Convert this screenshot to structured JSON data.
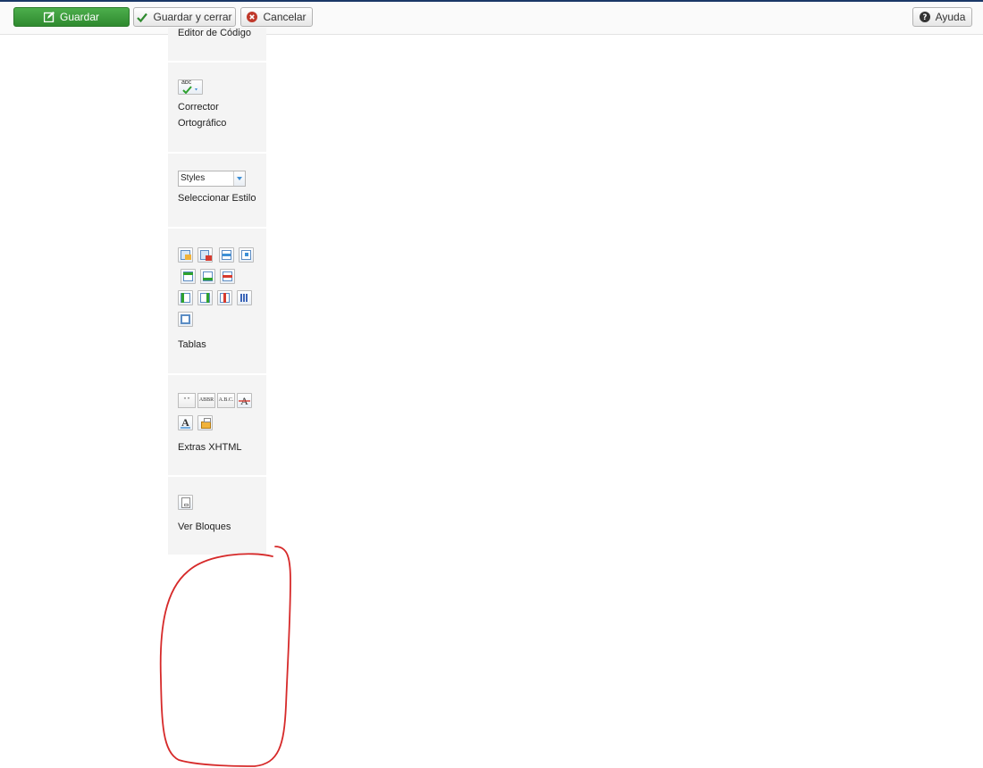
{
  "toolbar": {
    "save_label": "Guardar",
    "save_close_label": "Guardar y cerrar",
    "cancel_label": "Cancelar",
    "help_label": "Ayuda"
  },
  "editor_plugins": {
    "code_editor": {
      "label": "Editor de Código"
    },
    "spell_checker": {
      "label_line1": "Corrector",
      "label_line2": "Ortográfico",
      "icon_text": "abc"
    },
    "style_select": {
      "select_value": "Styles",
      "label": "Seleccionar Estilo"
    },
    "tables": {
      "label": "Tablas"
    },
    "xhtml_extras": {
      "label": "Extras XHTML",
      "icon_cite": "“ ”",
      "icon_abbr": "ABBR",
      "icon_acronym": "A.B.C."
    },
    "show_blocks": {
      "label": "Ver Bloques"
    }
  },
  "colors": {
    "save_button": "#3c9a3c",
    "annotation_stroke": "#d62a2a",
    "panel_background": "#f4f4f4"
  }
}
